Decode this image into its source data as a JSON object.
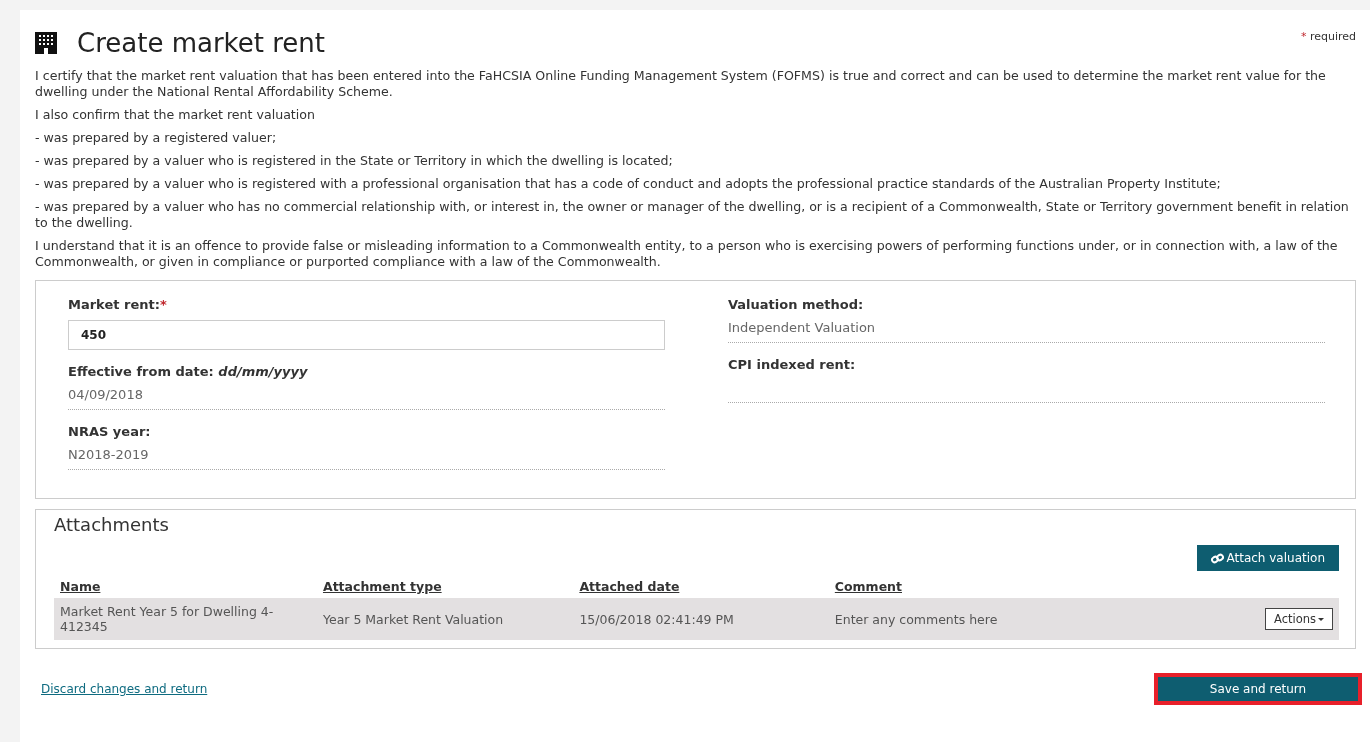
{
  "page": {
    "title": "Create market rent",
    "required_star": "*",
    "required_note": "required"
  },
  "declaration": [
    "I certify that the market rent valuation that has been entered into the FaHCSIA Online Funding Management System (FOFMS) is true and correct and can be used to determine the market rent value for the dwelling under the National Rental Affordability Scheme.",
    "I also confirm that the market rent valuation",
    " - was prepared by a registered valuer;",
    " - was prepared by a valuer who is registered in the State or Territory in which the dwelling is located;",
    " - was prepared by a valuer who is registered with a professional organisation that has a code of conduct and adopts the professional practice standards of the Australian Property Institute;",
    " - was prepared by a valuer who has no commercial relationship with, or interest in, the owner or manager of the dwelling, or is a recipient of a Commonwealth, State or Territory government benefit in relation to the dwelling.",
    "I understand that it is an offence to provide false or misleading information to a Commonwealth entity, to a person who is exercising powers of performing functions under, or in connection with, a law of the Commonwealth, or given in compliance or purported compliance with a law of the Commonwealth."
  ],
  "form": {
    "columns": [
      [
        {
          "kind": "input",
          "label": "Market rent:",
          "required_mark": "*",
          "value": "450"
        },
        {
          "kind": "readonly",
          "label": "Effective from date: *dd/mm/yyyy*",
          "value": "04/09/2018"
        },
        {
          "kind": "readonly",
          "label": "NRAS year:",
          "value": "N2018-2019"
        }
      ],
      [
        {
          "kind": "readonly",
          "label": "Valuation method:",
          "value": "Independent Valuation"
        },
        {
          "kind": "readonly",
          "label": "CPI indexed rent:"
        }
      ]
    ]
  },
  "attachments": {
    "title": "Attachments",
    "attach_button": "Attach valuation",
    "columns": [
      "Name",
      "Attachment type",
      "Attached date",
      "Comment"
    ],
    "rows": [
      {
        "cells": [
          "Market Rent Year 5 for Dwelling 4-412345",
          "Year 5 Market Rent Valuation",
          "15/06/2018 02:41:49 PM",
          "Enter any comments here"
        ],
        "action": "Actions"
      }
    ]
  },
  "footer": {
    "discard_link": "Discard changes and return",
    "save_button": {
      "label": "Save and return",
      "highlighted": true
    }
  }
}
